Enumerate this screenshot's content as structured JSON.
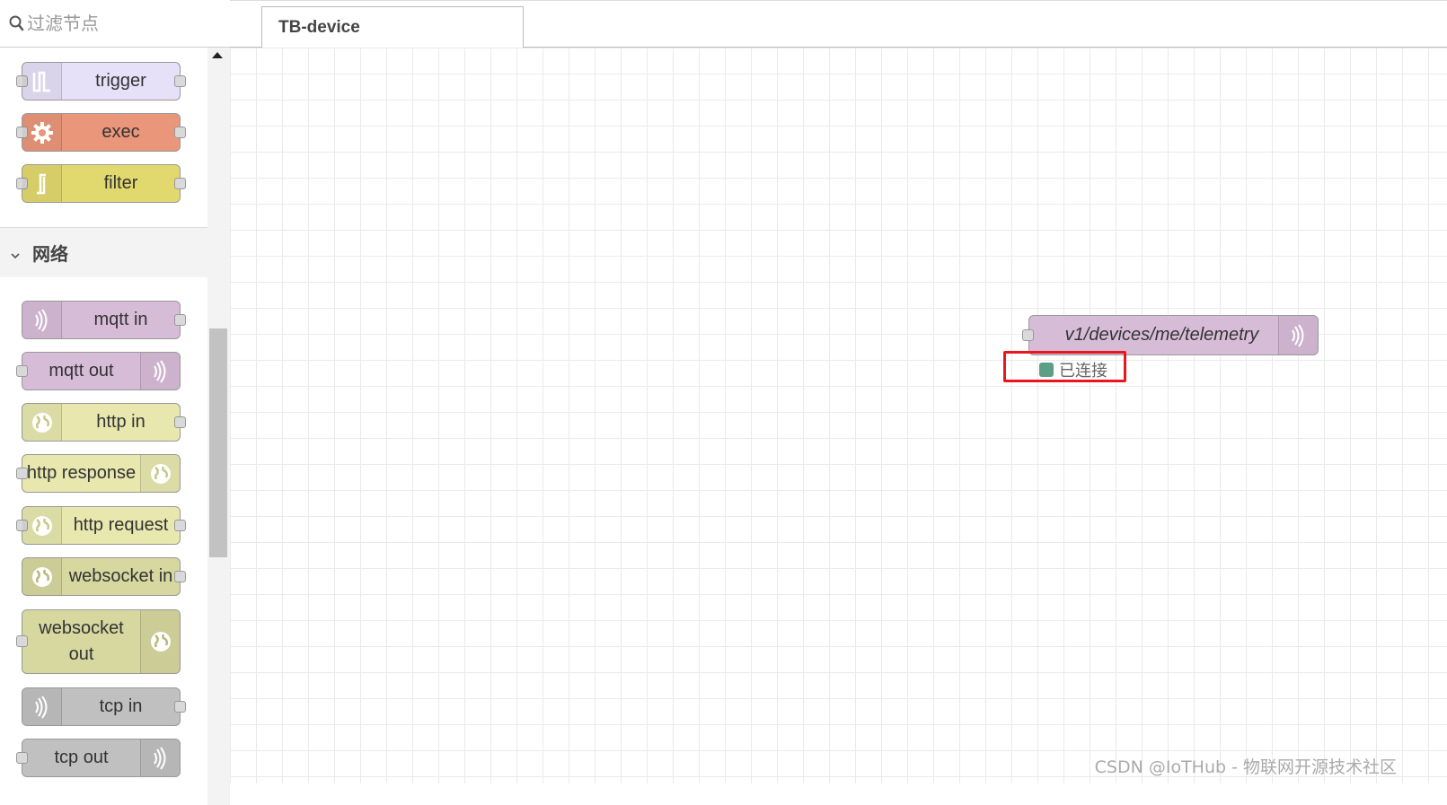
{
  "palette": {
    "filter_placeholder": "过滤节点",
    "category_network": "网络",
    "nodes": [
      {
        "label": "trigger",
        "color": "#e6e0f8",
        "icon": "trigger-icon",
        "icon_side": "left",
        "in": true,
        "out": true
      },
      {
        "label": "exec",
        "color": "#e9967a",
        "icon": "cog-icon",
        "icon_side": "left",
        "in": true,
        "out": true
      },
      {
        "label": "filter",
        "color": "#e2d96e",
        "icon": "filter-icon",
        "icon_side": "left",
        "in": true,
        "out": true
      },
      {
        "label": "mqtt in",
        "color": "#d7bcd8",
        "icon": "bridge-icon",
        "icon_side": "left",
        "in": false,
        "out": true
      },
      {
        "label": "mqtt out",
        "color": "#d7bcd8",
        "icon": "bridge-icon",
        "icon_side": "right",
        "in": true,
        "out": false
      },
      {
        "label": "http in",
        "color": "#e7e7ae",
        "icon": "globe-icon",
        "icon_side": "left",
        "in": false,
        "out": true
      },
      {
        "label": "http response",
        "color": "#e7e7ae",
        "icon": "globe-icon",
        "icon_side": "right",
        "in": true,
        "out": false
      },
      {
        "label": "http request",
        "color": "#e7e7ae",
        "icon": "globe-icon",
        "icon_side": "left",
        "in": true,
        "out": true
      },
      {
        "label": "websocket in",
        "color": "#d7d7a0",
        "icon": "globe-icon",
        "icon_side": "left",
        "in": false,
        "out": true
      },
      {
        "label": "websocket out",
        "label_lines": [
          "websocket",
          "out"
        ],
        "color": "#d7d7a0",
        "icon": "globe-icon",
        "icon_side": "right",
        "in": true,
        "out": false
      },
      {
        "label": "tcp in",
        "color": "#c0c0c0",
        "icon": "bridge-icon",
        "icon_side": "left",
        "in": false,
        "out": true
      },
      {
        "label": "tcp out",
        "color": "#c0c0c0",
        "icon": "bridge-icon",
        "icon_side": "right",
        "in": true,
        "out": false
      }
    ]
  },
  "workspace": {
    "tab_label": "TB-device",
    "flow_node": {
      "label": "v1/devices/me/telemetry",
      "color": "#d7bcd8",
      "icon": "bridge-icon"
    },
    "status": {
      "text": "已连接",
      "dot_color": "#5a9f86"
    },
    "highlight_color": "#e8161e"
  },
  "watermark": "CSDN @IoTHub - 物联网开源技术社区"
}
